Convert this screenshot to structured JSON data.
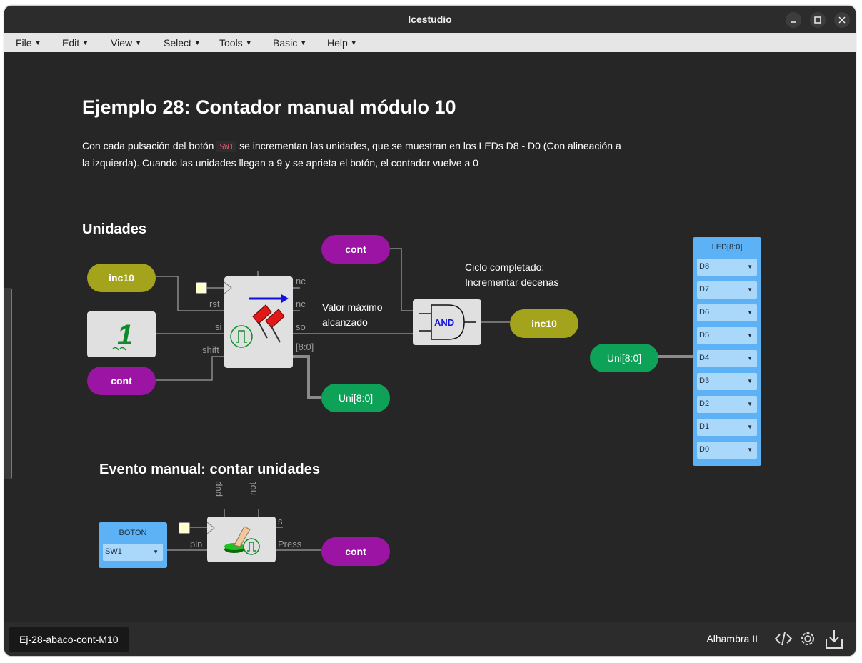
{
  "window": {
    "title": "Icestudio"
  },
  "menu": [
    {
      "label": "File"
    },
    {
      "label": "Edit"
    },
    {
      "label": "View"
    },
    {
      "label": "Select"
    },
    {
      "label": "Tools"
    },
    {
      "label": "Basic"
    },
    {
      "label": "Help"
    }
  ],
  "doc": {
    "title": "Ejemplo 28: Contador manual módulo 10",
    "desc_pre": "Con cada pulsación del botón ",
    "desc_code": "SW1",
    "desc_post": " se incrementan las unidades, que se muestran en los LEDs D8 - D0 (Con alineación a la izquierda). Cuando las unidades llegan a 9 y se aprieta el botón, el contador vuelve a 0"
  },
  "sections": {
    "unidades": "Unidades",
    "evento": "Evento manual: contar unidades"
  },
  "labels": {
    "inc10_in": "inc10",
    "cont_in1": "cont",
    "cont_top": "cont",
    "inc10_out": "inc10",
    "uni_out1": "Uni[8:0]",
    "uni_in": "Uni[8:0]",
    "cont_out": "cont",
    "and": "AND",
    "one": "1"
  },
  "ports": {
    "counter": {
      "rst": "rst",
      "si": "si",
      "shift": "shift",
      "nc1": "nc",
      "nc2": "nc",
      "so": "so",
      "bus": "[8:0]"
    },
    "button": {
      "pup": "pup",
      "not": "not",
      "pin": "pin",
      "s": "s",
      "press": "Press"
    }
  },
  "notes": {
    "valor": [
      "Valor máximo",
      "alcanzado"
    ],
    "ciclo": [
      "Ciclo completado:",
      "Incrementar decenas"
    ]
  },
  "led": {
    "title": "LED[8:0]",
    "pins": [
      "D8",
      "D7",
      "D6",
      "D5",
      "D4",
      "D3",
      "D2",
      "D1",
      "D0"
    ]
  },
  "boton": {
    "title": "BOTON",
    "pin": "SW1"
  },
  "status": {
    "file": "Ej-28-abaco-cont-M10",
    "board": "Alhambra II"
  },
  "colors": {
    "purple": "#9c14a4",
    "olive": "#a4a41c",
    "green": "#0ea158",
    "io_blue": "#5cb2f4",
    "canvas": "#262626"
  }
}
